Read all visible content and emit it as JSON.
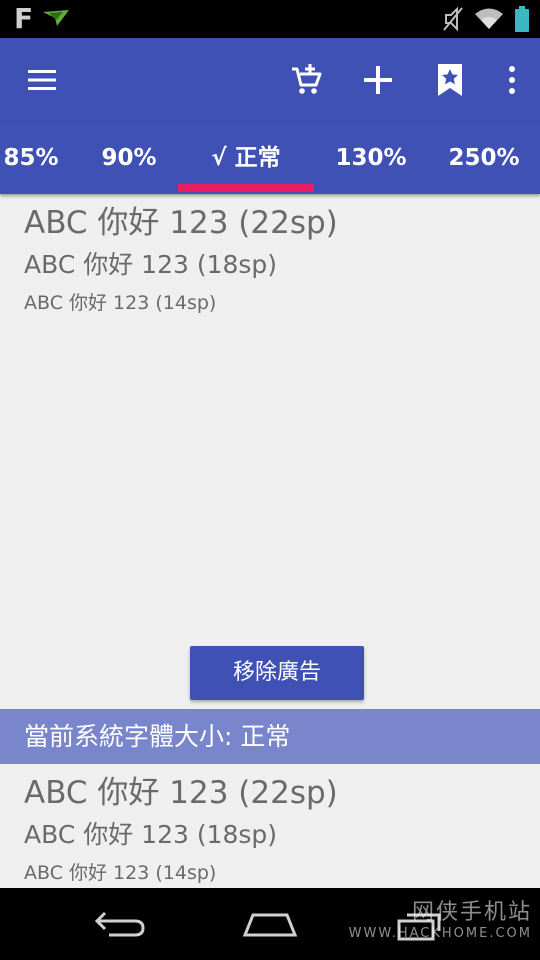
{
  "status_bar": {
    "app_letter": "F",
    "icons": [
      "app-notification-icon",
      "bird-notification-icon",
      "mute-icon",
      "wifi-icon",
      "battery-icon"
    ]
  },
  "toolbar": {
    "color": "#3f51b5",
    "icons": [
      "menu-icon",
      "cart-add-icon",
      "add-icon",
      "bookmark-star-icon",
      "more-vert-icon"
    ]
  },
  "tabs": {
    "items": [
      {
        "label": "85%"
      },
      {
        "label": "90%"
      },
      {
        "label": "√ 正常",
        "selected": true
      },
      {
        "label": "130%"
      },
      {
        "label": "250%"
      }
    ],
    "indicator_color": "#e91e63"
  },
  "samples_top": {
    "s22": "ABC 你好 123 (22sp)",
    "s18": "ABC 你好 123 (18sp)",
    "s14": "ABC 你好 123 (14sp)"
  },
  "remove_ads": {
    "label": "移除廣告"
  },
  "current": {
    "label": "當前系統字體大小: 正常",
    "color": "#7986cb"
  },
  "samples_bottom": {
    "s22": "ABC 你好 123 (22sp)",
    "s18": "ABC 你好 123 (18sp)",
    "s14": "ABC 你好 123 (14sp)"
  },
  "nav_bar": {
    "icons": [
      "back-icon",
      "home-icon",
      "recents-icon"
    ]
  },
  "watermark": {
    "cn": "网侠手机站",
    "url": "WWW.HACKHOME.COM"
  }
}
